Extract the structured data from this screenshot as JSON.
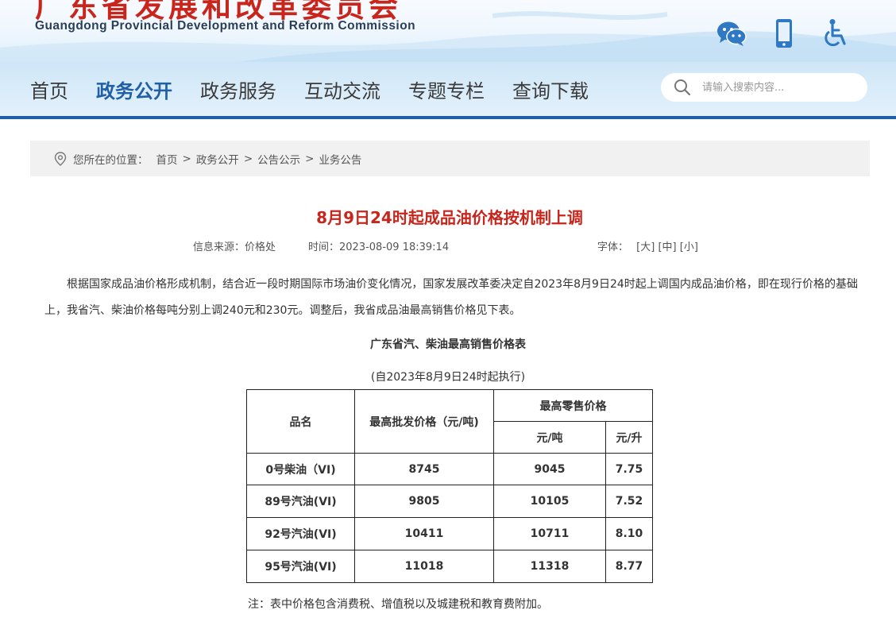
{
  "header": {
    "logo_cn": "广东省发展和改革委员会",
    "logo_en": "Guangdong Provincial Development and Reform Commission",
    "icons": [
      "wechat-icon",
      "mobile-icon",
      "accessibility-icon"
    ]
  },
  "nav": {
    "items": [
      "首页",
      "政务公开",
      "政务服务",
      "互动交流",
      "专题专栏",
      "查询下载"
    ],
    "active_index": 1,
    "search_placeholder": "请输入搜索内容..."
  },
  "breadcrumb": {
    "prefix": "您所在的位置：",
    "items": [
      "首页",
      "政务公开",
      "公告公示",
      "业务公告"
    ],
    "separator": ">"
  },
  "article": {
    "title": "8月9日24时起成品油价格按机制上调",
    "source_label": "信息来源：",
    "source": "价格处",
    "time_label": "时间：",
    "time": "2023-08-09 18:39:14",
    "font_label": "字体：",
    "font_sizes": [
      "[大]",
      "[中]",
      "[小]"
    ],
    "paragraph": "根据国家成品油价格形成机制，结合近一段时期国际市场油价变化情况，国家发展改革委决定自2023年8月9日24时起上调国内成品油价格，即在现行价格的基础上，我省汽、柴油价格每吨分别上调240元和230元。调整后，我省成品油最高销售价格见下表。",
    "table_title": "广东省汽、柴油最高销售价格表",
    "table_subtitle": "(自2023年8月9日24时起执行)",
    "table": {
      "col_name": "品名",
      "col_wholesale": "最高批发价格（元/吨)",
      "col_retail": "最高零售价格",
      "col_retail_ton": "元/吨",
      "col_retail_liter": "元/升",
      "rows": [
        {
          "name": "0号柴油（VI)",
          "wholesale": "8745",
          "retail_ton": "9045",
          "retail_liter": "7.75"
        },
        {
          "name": "89号汽油(VI)",
          "wholesale": "9805",
          "retail_ton": "10105",
          "retail_liter": "7.52"
        },
        {
          "name": "92号汽油(VI)",
          "wholesale": "10411",
          "retail_ton": "10711",
          "retail_liter": "8.10"
        },
        {
          "name": "95号汽油(VI)",
          "wholesale": "11018",
          "retail_ton": "11318",
          "retail_liter": "8.77"
        }
      ]
    },
    "note": "注：表中价格包含消费税、增值税以及城建税和教育费附加。"
  },
  "colors": {
    "brand_red": "#c8251c",
    "nav_blue": "#1f5fa6",
    "nav_bg": "#d8ecf9"
  }
}
